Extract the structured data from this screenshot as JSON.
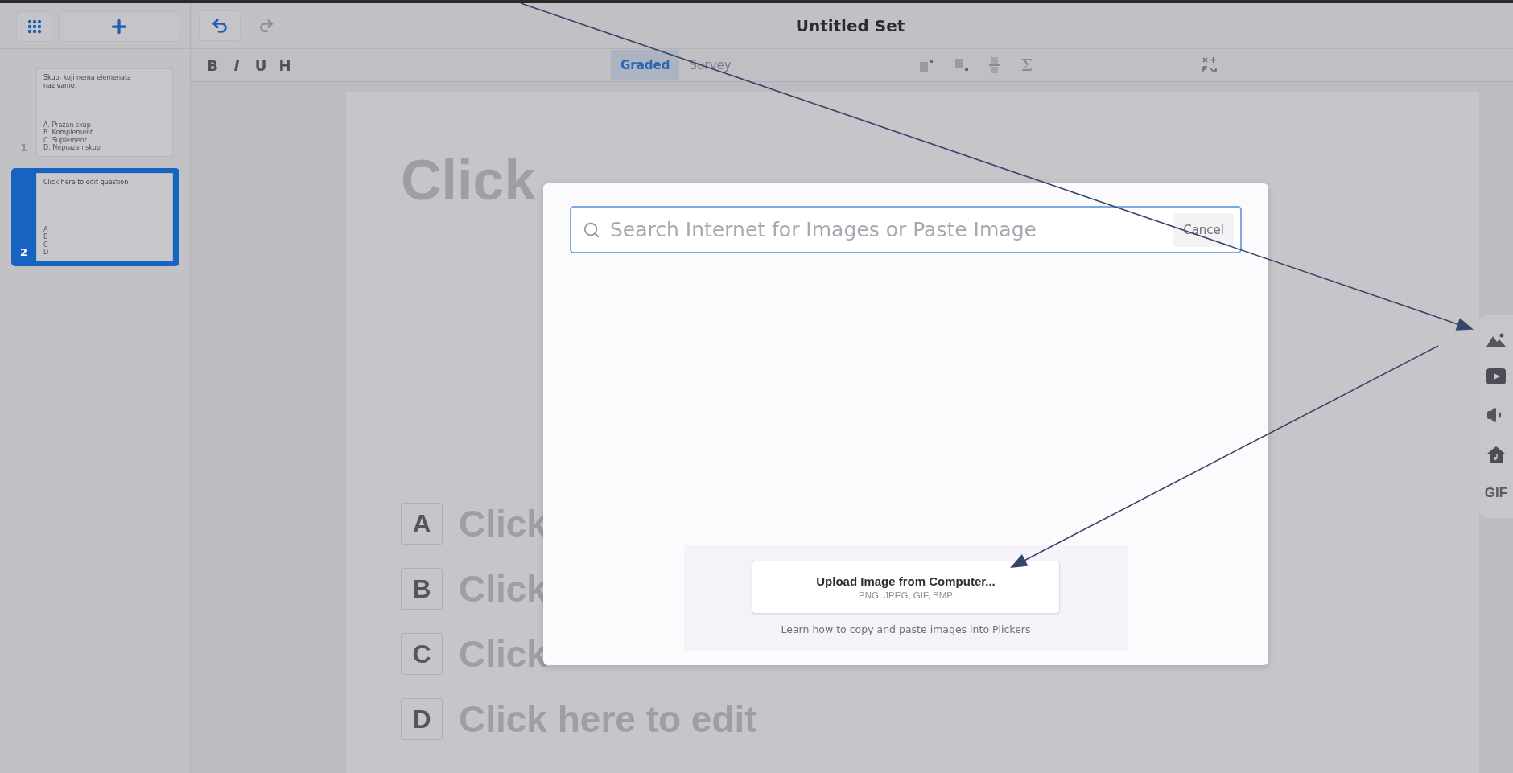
{
  "title": "Untitled Set",
  "format_buttons": [
    "B",
    "I",
    "U",
    "H"
  ],
  "modes": [
    {
      "label": "Graded",
      "selected": true
    },
    {
      "label": "Survey",
      "selected": false
    }
  ],
  "symbol_button": "Σ",
  "slides": [
    {
      "number": "1",
      "selected": false,
      "question": "Skup, koji nema elemenata nazivamo:",
      "choices": [
        "A. Prazan skup",
        "B. Komplement",
        "C. Suplement",
        "D. Neprazan skup"
      ]
    },
    {
      "number": "2",
      "selected": true,
      "question": "Click here to edit question",
      "choices": [
        "A",
        "B",
        "C",
        "D"
      ]
    }
  ],
  "question": "Click",
  "answers": [
    {
      "letter": "A",
      "text": "Click"
    },
    {
      "letter": "B",
      "text": "Click"
    },
    {
      "letter": "C",
      "text": "Click"
    },
    {
      "letter": "D",
      "text": "Click here to edit"
    }
  ],
  "dialog": {
    "search_placeholder": "Search Internet for Images or Paste Image",
    "cancel": "Cancel",
    "upload_title": "Upload Image from Computer...",
    "upload_formats": "PNG, JPEG, GIF, BMP",
    "help_link": "Learn how to copy and paste images into Plickers"
  },
  "media_tools": {
    "gif": "GIF"
  }
}
